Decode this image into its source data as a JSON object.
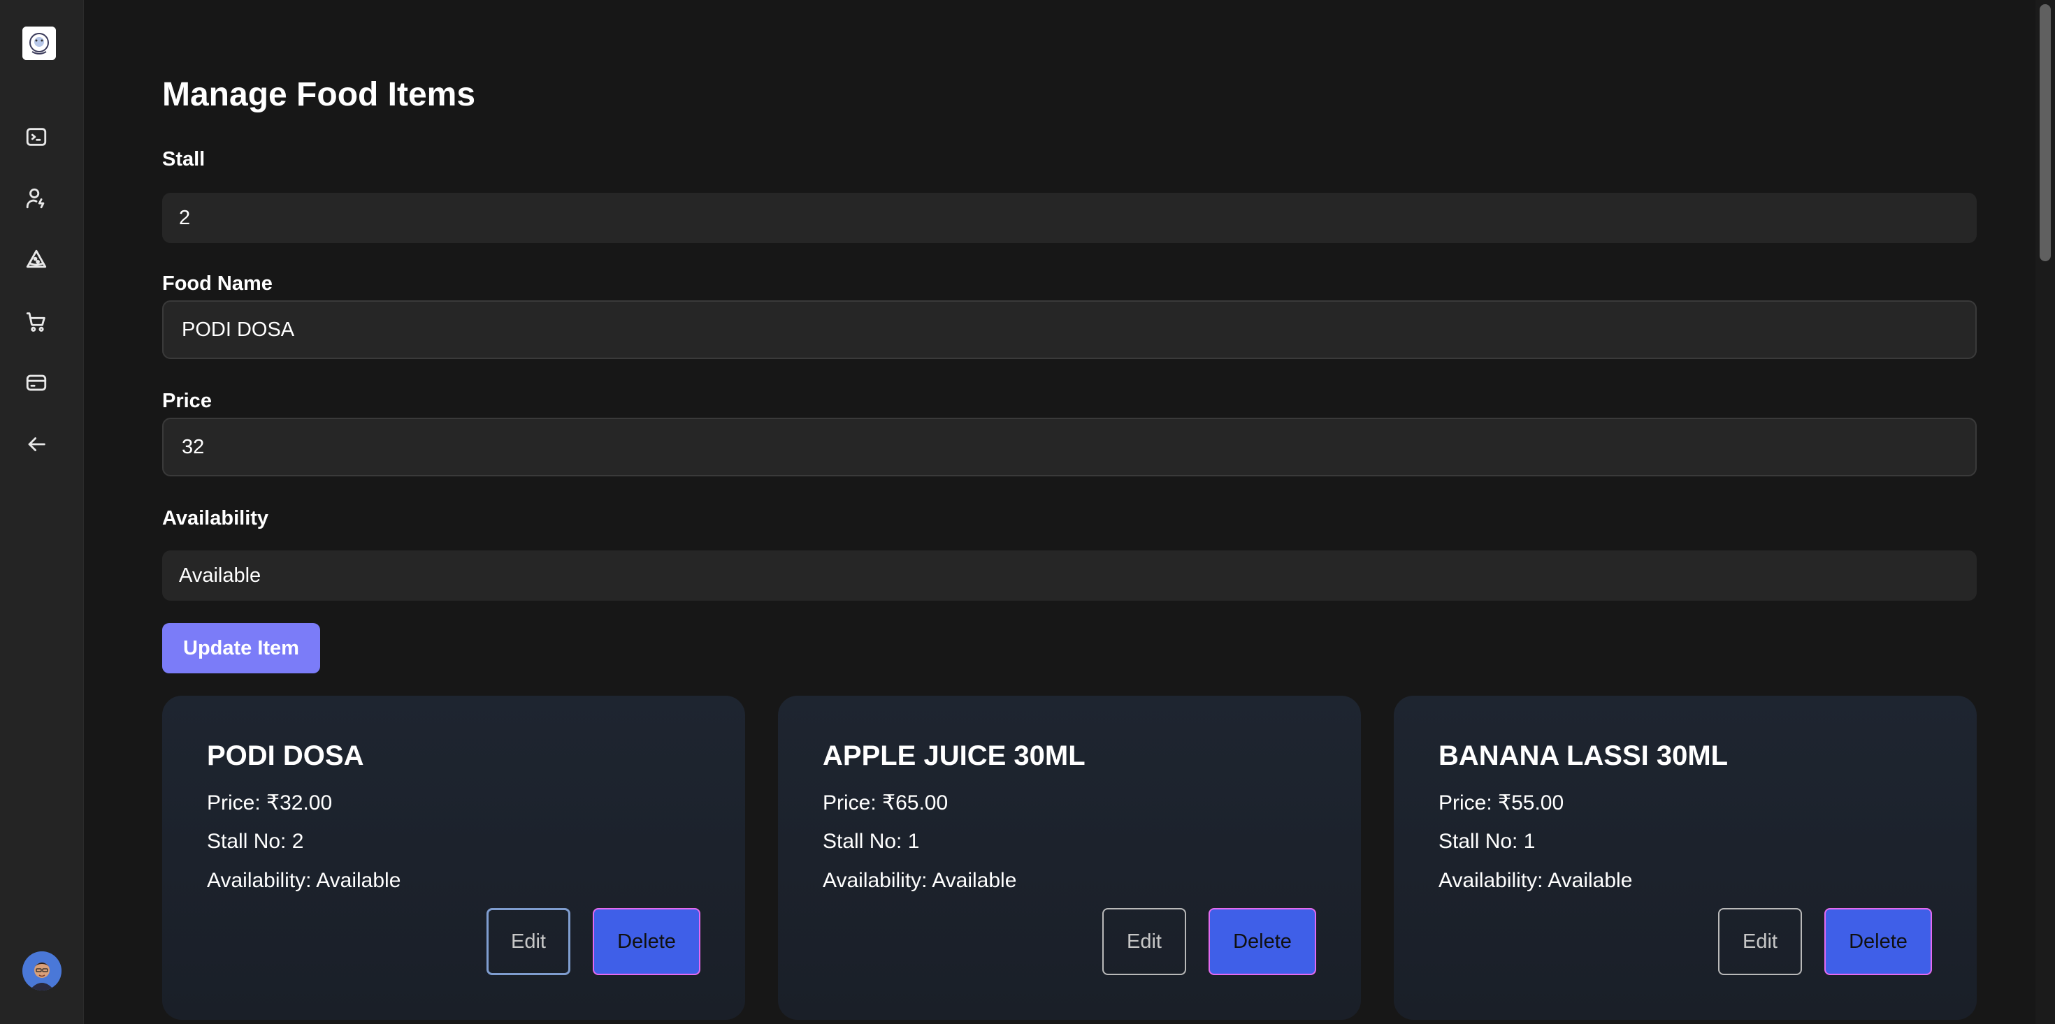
{
  "page": {
    "title": "Manage Food Items"
  },
  "form": {
    "stall_label": "Stall",
    "stall_value": "2",
    "food_name_label": "Food Name",
    "food_name_value": "PODI DOSA",
    "price_label": "Price",
    "price_value": "32",
    "availability_label": "Availability",
    "availability_value": "Available",
    "submit_label": "Update Item"
  },
  "sidebar": {
    "items": [
      {
        "icon": "terminal-icon"
      },
      {
        "icon": "user-settings-icon"
      },
      {
        "icon": "pizza-slice-icon"
      },
      {
        "icon": "cart-icon"
      },
      {
        "icon": "credit-card-icon"
      },
      {
        "icon": "arrow-left-icon"
      }
    ]
  },
  "cards": [
    {
      "name": "PODI DOSA",
      "price": "Price: ₹32.00",
      "stall": "Stall No: 2",
      "availability": "Availability: Available",
      "edit_label": "Edit",
      "delete_label": "Delete"
    },
    {
      "name": "APPLE JUICE 30ML",
      "price": "Price: ₹65.00",
      "stall": "Stall No: 1",
      "availability": "Availability: Available",
      "edit_label": "Edit",
      "delete_label": "Delete"
    },
    {
      "name": "BANANA LASSI 30ML",
      "price": "Price: ₹55.00",
      "stall": "Stall No: 1",
      "availability": "Availability: Available",
      "edit_label": "Edit",
      "delete_label": "Delete"
    }
  ],
  "colors": {
    "background": "#171717",
    "sidebar": "#242424",
    "primary": "#7b7cf8",
    "delete": "#3f5fe8",
    "delete_border": "#e46af0",
    "card": "#1e2530"
  }
}
